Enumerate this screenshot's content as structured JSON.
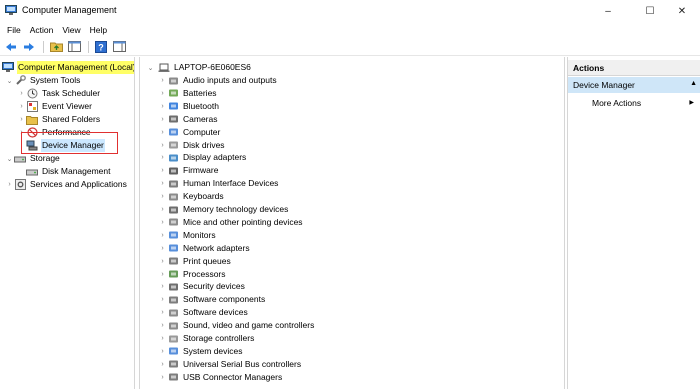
{
  "window": {
    "title": "Computer Management",
    "controls": [
      "–",
      "☐",
      "✕"
    ]
  },
  "menu": [
    "File",
    "Action",
    "View",
    "Help"
  ],
  "toolbar": {
    "buttons": [
      "back-icon",
      "forward-icon",
      "up-folder-icon",
      "show-hide-console-tree-icon",
      "help-icon",
      "show-action-pane-icon"
    ]
  },
  "tree": {
    "root": "Computer Management (Local)",
    "system_tools": "System Tools",
    "task_scheduler": "Task Scheduler",
    "event_viewer": "Event Viewer",
    "shared_folders": "Shared Folders",
    "performance": "Performance",
    "device_manager": "Device Manager",
    "storage": "Storage",
    "disk_management": "Disk Management",
    "services_apps": "Services and Applications"
  },
  "devices": {
    "computer_name": "LAPTOP-6E060ES6",
    "categories": [
      "Audio inputs and outputs",
      "Batteries",
      "Bluetooth",
      "Cameras",
      "Computer",
      "Disk drives",
      "Display adapters",
      "Firmware",
      "Human Interface Devices",
      "Keyboards",
      "Memory technology devices",
      "Mice and other pointing devices",
      "Monitors",
      "Network adapters",
      "Print queues",
      "Processors",
      "Security devices",
      "Software components",
      "Software devices",
      "Sound, video and game controllers",
      "Storage controllers",
      "System devices",
      "Universal Serial Bus controllers",
      "USB Connector Managers"
    ]
  },
  "actions": {
    "header": "Actions",
    "section": "Device Manager",
    "more": "More Actions"
  }
}
